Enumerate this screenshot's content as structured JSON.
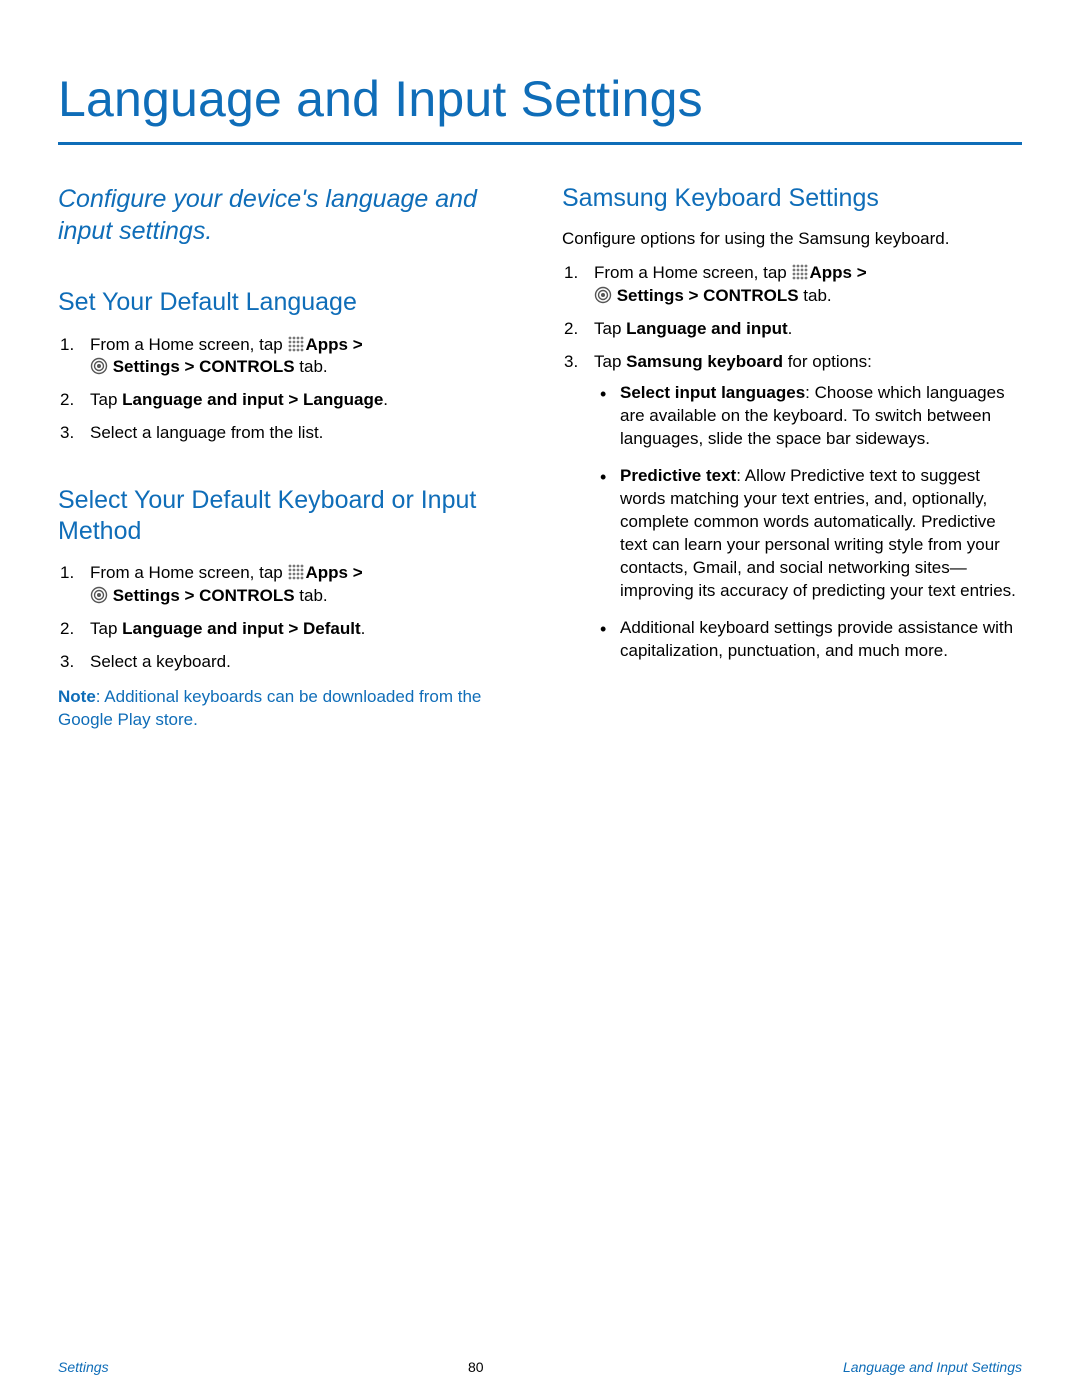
{
  "page": {
    "title": "Language and Input Settings",
    "intro": "Configure your device's language and input settings."
  },
  "left": {
    "section1": {
      "heading": "Set Your Default Language",
      "s1_pre": "From a Home screen, tap ",
      "s1_apps": "Apps >",
      "s1_settings": " Settings > CONTROLS",
      "s1_tab": " tab.",
      "s2_pre": "Tap ",
      "s2_bold": "Language and input > Language",
      "s2_post": ".",
      "s3": "Select a language from the list."
    },
    "section2": {
      "heading": "Select Your Default Keyboard or Input Method",
      "s1_pre": "From a Home screen, tap ",
      "s1_apps": "Apps >",
      "s1_settings": " Settings > CONTROLS",
      "s1_tab": " tab.",
      "s2_pre": "Tap ",
      "s2_bold": "Language and input > Default",
      "s2_post": ".",
      "s3": "Select a keyboard.",
      "note_bold": "Note",
      "note_text": ": Additional keyboards can be downloaded from the Google Play store."
    }
  },
  "right": {
    "section1": {
      "heading": "Samsung Keyboard Settings",
      "intro": "Configure options for using the Samsung keyboard.",
      "s1_pre": "From a Home screen, tap ",
      "s1_apps": "Apps >",
      "s1_settings": " Settings > CONTROLS",
      "s1_tab": " tab.",
      "s2_pre": "Tap ",
      "s2_bold": "Language and input",
      "s2_post": ".",
      "s3_pre": "Tap ",
      "s3_bold": "Samsung keyboard",
      "s3_post": " for options:",
      "b1_bold": "Select input languages",
      "b1_text": ": Choose which languages are available on the keyboard. To switch between languages, slide the space bar sideways.",
      "b2_bold": "Predictive text",
      "b2_text": ": Allow Predictive text to suggest words matching your text entries, and, optionally, complete common words automatically. Predictive text can learn your personal writing style from your contacts, Gmail, and social networking sites—improving its accuracy of predicting your text entries.",
      "b3_text": "Additional keyboard settings provide assistance with capitalization, punctuation, and much more."
    }
  },
  "footer": {
    "left": "Settings",
    "center": "80",
    "right": "Language and Input Settings"
  }
}
